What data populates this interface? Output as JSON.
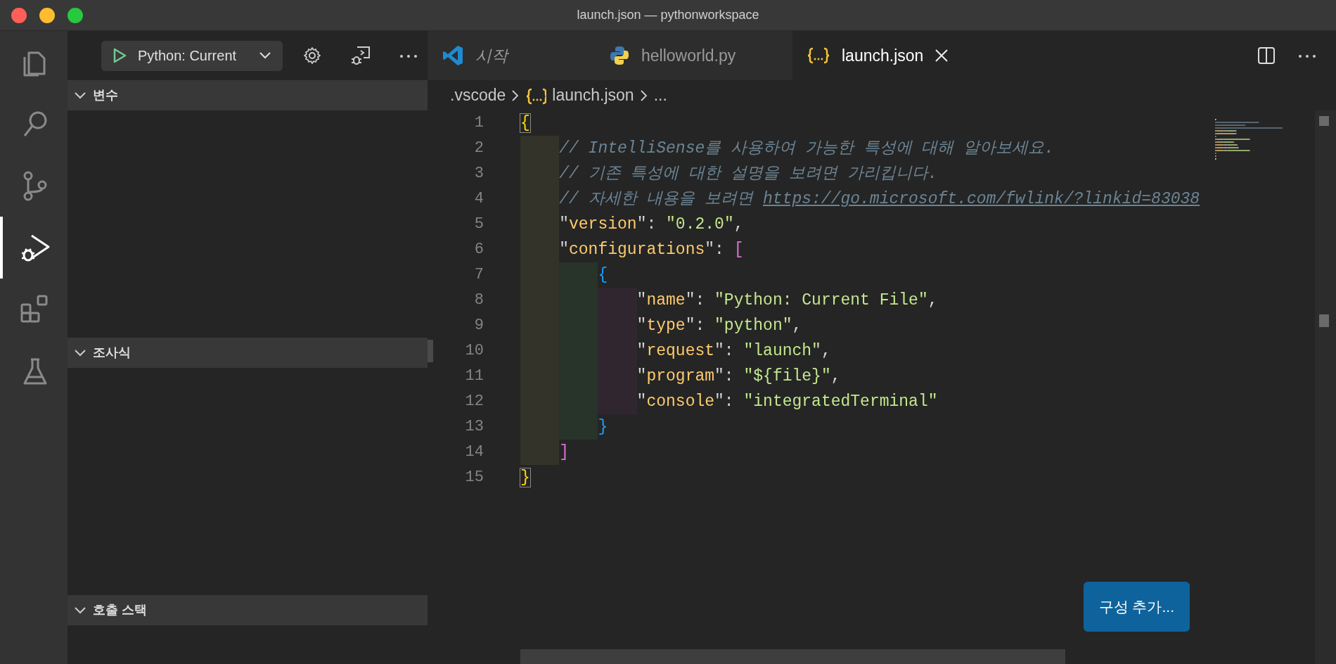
{
  "window": {
    "title": "launch.json — pythonworkspace"
  },
  "activity_bar": [
    {
      "selected": false
    },
    {
      "selected": false
    },
    {
      "selected": false
    },
    {
      "selected": true
    },
    {
      "selected": false
    },
    {
      "selected": false
    }
  ],
  "debug_toolbar": {
    "configuration": "Python: Current"
  },
  "sections": [
    {
      "title": "변수",
      "expanded": true
    },
    {
      "title": "조사식",
      "expanded": true
    },
    {
      "title": "호출 스택",
      "expanded": true
    }
  ],
  "tabs": [
    {
      "label": "시작",
      "preview": true,
      "selected": false
    },
    {
      "label": "helloworld.py",
      "preview": false,
      "selected": false
    },
    {
      "label": "launch.json",
      "preview": false,
      "selected": true
    }
  ],
  "breadcrumbs": [
    ".vscode",
    "launch.json",
    "..."
  ],
  "editor": {
    "lines": [
      {
        "number": "1",
        "current": false,
        "tokens": [
          {
            "kind": "bracket-match",
            "text": "{",
            "color": "#ffd700"
          }
        ]
      },
      {
        "number": "2",
        "current": false,
        "guides": [
          {
            "color": "#33332a"
          }
        ],
        "tokens": [
          {
            "kind": "comment",
            "text": "// IntelliSense를 사용하여 가능한 특성에 대해 알아보세요."
          }
        ]
      },
      {
        "number": "3",
        "current": false,
        "guides": [
          {
            "color": "#33332a"
          }
        ],
        "tokens": [
          {
            "kind": "comment",
            "text": "// 기존 특성에 대한 설명을 보려면 가리킵니다."
          }
        ]
      },
      {
        "number": "4",
        "current": false,
        "guides": [
          {
            "color": "#33332a"
          }
        ],
        "tokens": [
          {
            "kind": "comment",
            "text": "// 자세한 내용을 보려면 "
          },
          {
            "kind": "link",
            "text": "https://go.microsoft.com/fwlink/?linkid=83038"
          }
        ]
      },
      {
        "number": "5",
        "current": false,
        "guides": [
          {
            "color": "#33332a"
          }
        ],
        "tokens": [
          {
            "kind": "punct",
            "text": "\""
          },
          {
            "kind": "key",
            "text": "version"
          },
          {
            "kind": "punct",
            "text": "\": "
          },
          {
            "kind": "string",
            "text": "\"0.2.0\""
          },
          {
            "kind": "punct",
            "text": ","
          }
        ]
      },
      {
        "number": "6",
        "current": false,
        "guides": [
          {
            "color": "#33332a"
          }
        ],
        "tokens": [
          {
            "kind": "punct",
            "text": "\""
          },
          {
            "kind": "key",
            "text": "configurations"
          },
          {
            "kind": "punct",
            "text": "\": "
          },
          {
            "kind": "bracket",
            "text": "[",
            "color": "#da70d6"
          }
        ]
      },
      {
        "number": "7",
        "current": false,
        "guides": [
          {
            "color": "#33332a"
          },
          {
            "color": "#283329"
          }
        ],
        "tokens": [
          {
            "kind": "bracket",
            "text": "{",
            "color": "#179fff"
          }
        ]
      },
      {
        "number": "8",
        "current": false,
        "guides": [
          {
            "color": "#33332a"
          },
          {
            "color": "#283329"
          },
          {
            "color": "#30262f"
          }
        ],
        "tokens": [
          {
            "kind": "punct",
            "text": "\""
          },
          {
            "kind": "key",
            "text": "name"
          },
          {
            "kind": "punct",
            "text": "\": "
          },
          {
            "kind": "string",
            "text": "\"Python: Current File\""
          },
          {
            "kind": "punct",
            "text": ","
          }
        ]
      },
      {
        "number": "9",
        "current": false,
        "guides": [
          {
            "color": "#33332a"
          },
          {
            "color": "#283329"
          },
          {
            "color": "#30262f"
          }
        ],
        "tokens": [
          {
            "kind": "punct",
            "text": "\""
          },
          {
            "kind": "key",
            "text": "type"
          },
          {
            "kind": "punct",
            "text": "\": "
          },
          {
            "kind": "string",
            "text": "\"python\""
          },
          {
            "kind": "punct",
            "text": ","
          }
        ]
      },
      {
        "number": "10",
        "current": true,
        "guides": [
          {
            "color": "#33332a"
          },
          {
            "color": "#283329"
          },
          {
            "color": "#30262f"
          }
        ],
        "tokens": [
          {
            "kind": "punct",
            "text": "\""
          },
          {
            "kind": "key",
            "text": "request"
          },
          {
            "kind": "punct",
            "text": "\": "
          },
          {
            "kind": "string",
            "text": "\"launch\""
          },
          {
            "kind": "punct",
            "text": ","
          }
        ]
      },
      {
        "number": "11",
        "current": false,
        "guides": [
          {
            "color": "#33332a"
          },
          {
            "color": "#283329"
          },
          {
            "color": "#30262f"
          }
        ],
        "tokens": [
          {
            "kind": "punct",
            "text": "\""
          },
          {
            "kind": "key",
            "text": "program"
          },
          {
            "kind": "punct",
            "text": "\": "
          },
          {
            "kind": "string",
            "text": "\"${file}\""
          },
          {
            "kind": "punct",
            "text": ","
          }
        ]
      },
      {
        "number": "12",
        "current": false,
        "guides": [
          {
            "color": "#33332a"
          },
          {
            "color": "#283329"
          },
          {
            "color": "#30262f"
          }
        ],
        "tokens": [
          {
            "kind": "punct",
            "text": "\""
          },
          {
            "kind": "key",
            "text": "console"
          },
          {
            "kind": "punct",
            "text": "\": "
          },
          {
            "kind": "string",
            "text": "\"integratedTerminal\""
          }
        ]
      },
      {
        "number": "13",
        "current": false,
        "guides": [
          {
            "color": "#33332a"
          },
          {
            "color": "#283329"
          }
        ],
        "tokens": [
          {
            "kind": "bracket",
            "text": "}",
            "color": "#179fff"
          }
        ]
      },
      {
        "number": "14",
        "current": false,
        "guides": [
          {
            "color": "#33332a"
          }
        ],
        "tokens": [
          {
            "kind": "bracket",
            "text": "]",
            "color": "#da70d6"
          }
        ]
      },
      {
        "number": "15",
        "current": false,
        "tokens": [
          {
            "kind": "bracket-match",
            "text": "}",
            "color": "#ffd700"
          }
        ]
      }
    ]
  },
  "add_configuration_button": "구성 추가..."
}
